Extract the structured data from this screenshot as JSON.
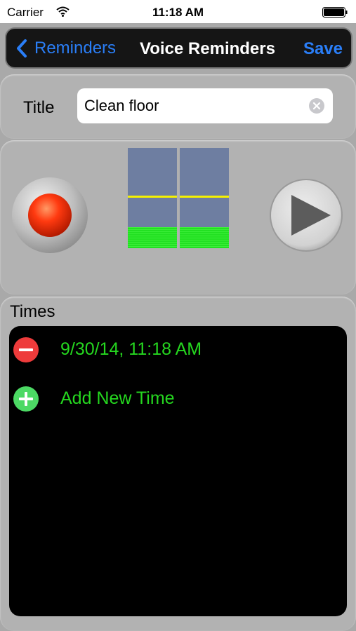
{
  "status_bar": {
    "carrier": "Carrier",
    "time": "11:18 AM"
  },
  "nav": {
    "back_label": "Reminders",
    "title": "Voice Reminders",
    "save_label": "Save"
  },
  "form": {
    "title_label": "Title",
    "title_value": "Clean floor"
  },
  "times": {
    "heading": "Times",
    "items": [
      {
        "label": "9/30/14, 11:18 AM",
        "icon": "remove-circle-icon"
      },
      {
        "label": "Add New Time",
        "icon": "add-circle-icon"
      }
    ]
  },
  "colors": {
    "accent_blue": "#2a7ef7",
    "time_text_green": "#25d71f",
    "remove_red": "#ee3b3b",
    "add_green": "#4cd964",
    "record_red": "#ff3300",
    "meter_level_green": "#22e022",
    "meter_marker_yellow": "#f6f200",
    "meter_bg": "#6e7ea1"
  }
}
